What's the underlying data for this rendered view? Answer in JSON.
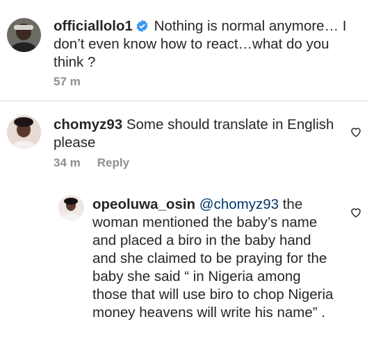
{
  "comments": [
    {
      "username": "officiallolo1",
      "verified": true,
      "text": "Nothing is normal anymore… I don’t even know how to react…what do you think ?",
      "time": "57 m"
    },
    {
      "username": "chomyz93",
      "text": "Some should translate in English please",
      "time": "34 m",
      "reply_label": "Reply"
    },
    {
      "username": "opeoluwa_osin",
      "mention": "@chomyz93",
      "text": "the woman mentioned the baby’s name and placed a biro in the baby hand and she claimed to be praying for the baby she said “ in Nigeria among those that will use biro to chop Nigeria money heavens will write his name” ."
    }
  ],
  "icons": {
    "verified": "verified-badge-icon",
    "like": "heart-icon"
  },
  "colors": {
    "verified": "#3897f0",
    "mention": "#00376b",
    "secondary": "#8e8e8e"
  }
}
